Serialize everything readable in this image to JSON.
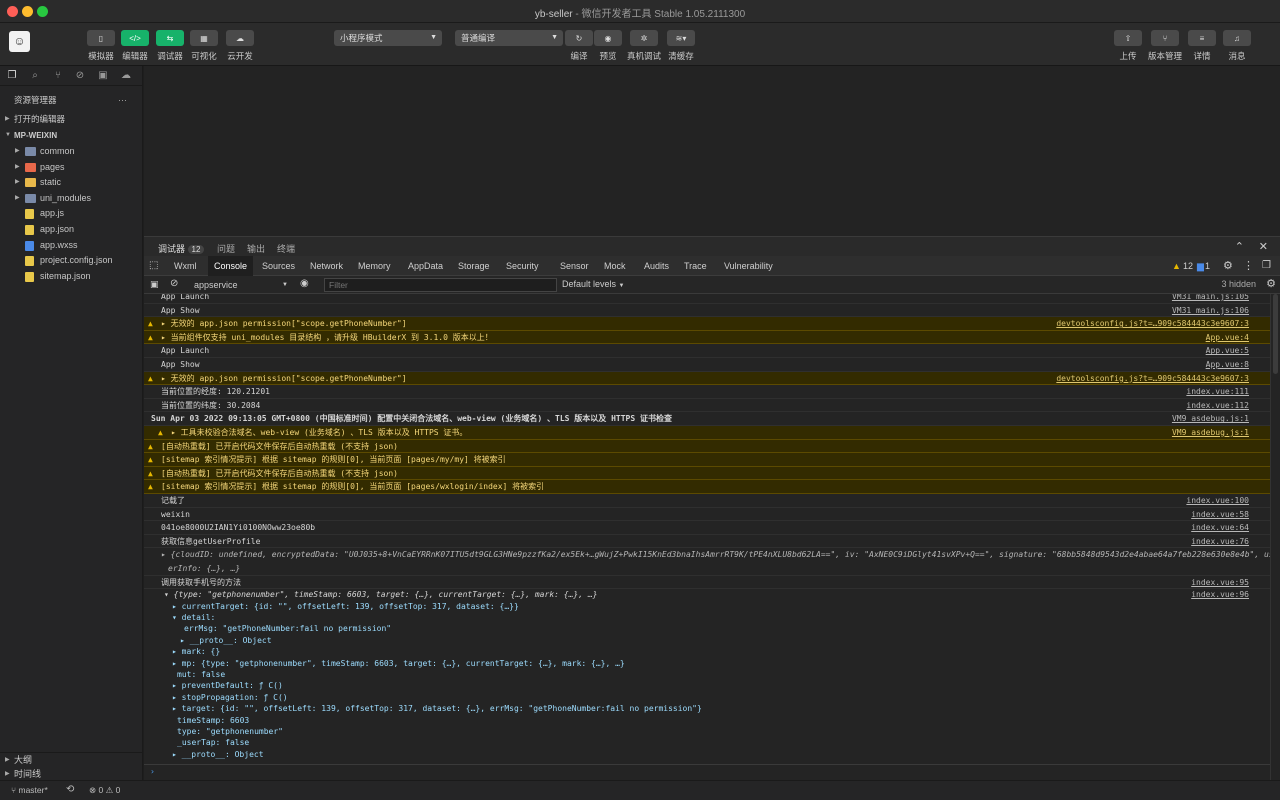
{
  "window": {
    "title_main": "yb-seller",
    "title_sub": "微信开发者工具 Stable 1.05.2111300"
  },
  "toolbar": {
    "left_buttons": [
      {
        "label": "模拟器",
        "active": false
      },
      {
        "label": "编辑器",
        "active": true
      },
      {
        "label": "调试器",
        "active": true
      },
      {
        "label": "可视化",
        "active": false
      },
      {
        "label": "云开发",
        "active": false
      }
    ],
    "mode_select": "小程序模式",
    "compile_select": "普通编译",
    "center_labels": [
      "编译",
      "预览",
      "真机调试",
      "清缓存"
    ],
    "right_labels": [
      "上传",
      "版本管理",
      "详情",
      "消息"
    ]
  },
  "sidebar": {
    "header": "资源管理器",
    "more": "···",
    "open_editors": "打开的编辑器",
    "project": "MP-WEIXIN",
    "items": [
      {
        "name": "common",
        "kind": "folder",
        "color": "#7a8aa8"
      },
      {
        "name": "pages",
        "kind": "folder",
        "color": "#e8684a"
      },
      {
        "name": "static",
        "kind": "folder",
        "color": "#e8b84a"
      },
      {
        "name": "uni_modules",
        "kind": "folder",
        "color": "#7a8aa8"
      },
      {
        "name": "app.js",
        "kind": "js",
        "color": "#e8c84a"
      },
      {
        "name": "app.json",
        "kind": "json",
        "color": "#e8c84a"
      },
      {
        "name": "app.wxss",
        "kind": "wxss",
        "color": "#4a8ae8"
      },
      {
        "name": "project.config.json",
        "kind": "json",
        "color": "#e8c84a"
      },
      {
        "name": "sitemap.json",
        "kind": "json",
        "color": "#e8c84a"
      }
    ],
    "outline": "大纲",
    "timeline": "时间线"
  },
  "devtools": {
    "top_tabs": [
      {
        "label": "调试器",
        "badge": "12"
      },
      {
        "label": "问题"
      },
      {
        "label": "输出"
      },
      {
        "label": "终端"
      }
    ],
    "panel_tabs": [
      "Wxml",
      "Console",
      "Sources",
      "Network",
      "Memory",
      "AppData",
      "Storage",
      "Security",
      "Sensor",
      "Mock",
      "Audits",
      "Trace",
      "Vulnerability"
    ],
    "active_tab": "Console",
    "warn_count": "12",
    "info_count": "1",
    "context": "appservice",
    "filter_placeholder": "Filter",
    "levels": "Default levels",
    "hidden": "3 hidden"
  },
  "console": [
    {
      "type": "log",
      "text": "App Launch",
      "src": "VM31 main.js:105"
    },
    {
      "type": "log",
      "text": "App Show",
      "src": "VM31 main.js:106"
    },
    {
      "type": "warn",
      "text": "▸ 无效的 app.json permission[\"scope.getPhoneNumber\"]",
      "src": "devtoolsconfig.js?t=…909c584443c3e9607:3"
    },
    {
      "type": "warn",
      "text": "▸ 当前组件仅支持 uni_modules 目录结构 ，请升级 HBuilderX 到 3.1.0 版本以上！",
      "src": "App.vue:4"
    },
    {
      "type": "log",
      "text": "App Launch",
      "src": "App.vue:5"
    },
    {
      "type": "log",
      "text": "App Show",
      "src": "App.vue:8"
    },
    {
      "type": "warn",
      "text": "▸ 无效的 app.json permission[\"scope.getPhoneNumber\"]",
      "src": "devtoolsconfig.js?t=…909c584443c3e9607:3"
    },
    {
      "type": "log",
      "text": "当前位置的经度: 120.21201",
      "src": "index.vue:111"
    },
    {
      "type": "log",
      "text": "当前位置的纬度: 30.2084",
      "src": "index.vue:112"
    },
    {
      "type": "group",
      "text": "Sun Apr 03 2022 09:13:05 GMT+0800 (中国标准时间) 配置中关闭合法域名、web-view (业务域名) 、TLS 版本以及 HTTPS 证书检查",
      "src": "VM9 asdebug.js:1"
    },
    {
      "type": "warn",
      "text": "▸ 工具未校验合法域名、web-view (业务域名) 、TLS 版本以及 HTTPS 证书。",
      "src": "VM9 asdebug.js:1",
      "indent": true
    },
    {
      "type": "warn",
      "text": "[自动热重载] 已开启代码文件保存后自动热重载 (不支持 json)",
      "src": ""
    },
    {
      "type": "warn",
      "text": "[sitemap 索引情况提示] 根据 sitemap 的规则[0], 当前页面 [pages/my/my] 将被索引",
      "src": ""
    },
    {
      "type": "warn",
      "text": "[自动热重载] 已开启代码文件保存后自动热重载 (不支持 json)",
      "src": ""
    },
    {
      "type": "warn",
      "text": "[sitemap 索引情况提示] 根据 sitemap 的规则[0], 当前页面 [pages/wxlogin/index] 将被索引",
      "src": ""
    },
    {
      "type": "log",
      "text": "记载了",
      "src": "index.vue:100"
    },
    {
      "type": "log",
      "text": "weixin",
      "src": "index.vue:58"
    },
    {
      "type": "log",
      "text": "041oe8000U2IAN1Yi0100NOww23oe80b",
      "src": "index.vue:64"
    }
  ],
  "userprofile": {
    "label": "获取信息getUserProfile",
    "src": "index.vue:76",
    "obj": "▸ {cloudID: undefined, encryptedData: \"U0J035+8+VnCaEYRRnK07ITU5dt9GLG3HNe9pzzfKa2/ex5Ek+…gWujZ+PwkI15KnEd3bnaIhsAmrrRT9K/tPE4nXLU8bd62LA==\", iv: \"AxNE0C9iDGlyt41svXPv+Q==\", signature: \"68bb5848d9543d2e4abae64a7feb228e630e8e4b\", us",
    "obj2": "erInfo: {…}, …}"
  },
  "phone": {
    "label": "调用获取手机号的方法",
    "src": "index.vue:95",
    "src2": "index.vue:96",
    "lines": [
      "▾ {type: \"getphonenumber\", timeStamp: 6603, target: {…}, currentTarget: {…}, mark: {…}, …}",
      "▸ currentTarget: {id: \"\", offsetLeft: 139, offsetTop: 317, dataset: {…}}",
      "▾ detail:",
      "errMsg: \"getPhoneNumber:fail no permission\"",
      "▸ __proto__: Object",
      "▸ mark: {}",
      "▸ mp: {type: \"getphonenumber\", timeStamp: 6603, target: {…}, currentTarget: {…}, mark: {…}, …}",
      "mut: false",
      "▸ preventDefault: ƒ C()",
      "▸ stopPropagation: ƒ C()",
      "▸ target: {id: \"\", offsetLeft: 139, offsetTop: 317, dataset: {…}, errMsg: \"getPhoneNumber:fail no permission\"}",
      "timeStamp: 6603",
      "type: \"getphonenumber\"",
      "_userTap: false",
      "▸ __proto__: Object"
    ]
  },
  "prompt": "›",
  "status": {
    "branch": "master*",
    "errors": "0",
    "warnings": "0"
  }
}
